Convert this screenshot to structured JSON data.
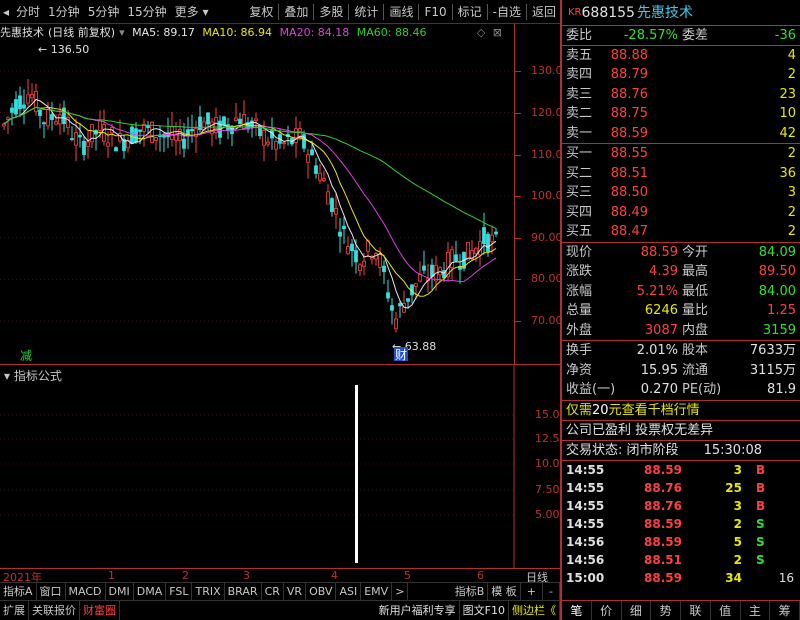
{
  "toolbar": {
    "tabs": [
      "分时",
      "1分钟",
      "5分钟",
      "15分钟",
      "更多"
    ],
    "actions": [
      "复权",
      "叠加",
      "多股",
      "统计",
      "画线",
      "F10",
      "标记",
      "-自选",
      "返回"
    ]
  },
  "chart_header": {
    "stock_name": "先惠技术",
    "period": "(日线 前复权)",
    "ma5": "MA5: 89.17",
    "ma10": "MA10: 86.94",
    "ma20": "MA20: 84.18",
    "ma60": "MA60: 88.46"
  },
  "chart_labels": {
    "high_mark": "136.50",
    "low_mark": "63.88",
    "reduce_marker": "减",
    "finance_marker": "财"
  },
  "price_axis": [
    "130.0",
    "120.0",
    "110.0",
    "100.0",
    "90.00",
    "80.00",
    "70.00"
  ],
  "indicator": {
    "title": "指标公式",
    "axis": [
      "15.00",
      "12.50",
      "10.00",
      "7.50",
      "5.00"
    ]
  },
  "time_axis": {
    "year": "2021年",
    "months": [
      "1",
      "2",
      "3",
      "4",
      "5",
      "6"
    ],
    "right_label": "日线"
  },
  "indicator_tabs": [
    "指标A",
    "窗口",
    "MACD",
    "DMI",
    "DMA",
    "FSL",
    "TRIX",
    "BRAR",
    "CR",
    "VR",
    "OBV",
    "ASI",
    "EMV",
    ">",
    "指标B",
    "模 板",
    "+",
    "-"
  ],
  "status_row": [
    "扩展",
    "关联报价",
    "财富圈",
    "新用户福利专享",
    "图文F10",
    "侧边栏《"
  ],
  "quote": {
    "prefix": "KR",
    "code": "688155",
    "name": "先惠技术",
    "weibi_label": "委比",
    "weibi_value": "-28.57%",
    "weicha_label": "委差",
    "weicha_value": "-36",
    "sells": [
      {
        "label": "卖五",
        "price": "88.88",
        "vol": "4"
      },
      {
        "label": "卖四",
        "price": "88.79",
        "vol": "2"
      },
      {
        "label": "卖三",
        "price": "88.76",
        "vol": "23"
      },
      {
        "label": "卖二",
        "price": "88.75",
        "vol": "10"
      },
      {
        "label": "卖一",
        "price": "88.59",
        "vol": "42"
      }
    ],
    "buys": [
      {
        "label": "买一",
        "price": "88.55",
        "vol": "2"
      },
      {
        "label": "买二",
        "price": "88.51",
        "vol": "36"
      },
      {
        "label": "买三",
        "price": "88.50",
        "vol": "3"
      },
      {
        "label": "买四",
        "price": "88.49",
        "vol": "2"
      },
      {
        "label": "买五",
        "price": "88.47",
        "vol": "2"
      }
    ],
    "stats": [
      {
        "l1": "现价",
        "v1": "88.59",
        "c1": "red",
        "l2": "今开",
        "v2": "84.09",
        "c2": "green"
      },
      {
        "l1": "涨跌",
        "v1": "4.39",
        "c1": "red",
        "l2": "最高",
        "v2": "89.50",
        "c2": "red"
      },
      {
        "l1": "涨幅",
        "v1": "5.21%",
        "c1": "red",
        "l2": "最低",
        "v2": "84.00",
        "c2": "green"
      },
      {
        "l1": "总量",
        "v1": "6246",
        "c1": "yellow",
        "l2": "量比",
        "v2": "1.25",
        "c2": "red"
      },
      {
        "l1": "外盘",
        "v1": "3087",
        "c1": "red",
        "l2": "内盘",
        "v2": "3159",
        "c2": "green"
      }
    ],
    "stats2": [
      {
        "l1": "换手",
        "v1": "2.01%",
        "l2": "股本",
        "v2": "7633万"
      },
      {
        "l1": "净资",
        "v1": "15.95",
        "l2": "流通",
        "v2": "3115万"
      },
      {
        "l1": "收益(一)",
        "v1": "0.270",
        "l2": "PE(动)",
        "v2": "81.9"
      }
    ],
    "promo": "仅需20元查看千档行情",
    "promo_num": "20",
    "notice": "公司已盈利 投票权无差异",
    "trade_status_label": "交易状态: 闭市阶段",
    "trade_status_time": "15:30:08",
    "trades": [
      {
        "time": "14:55",
        "price": "88.59",
        "vol": "3",
        "side": "B"
      },
      {
        "time": "14:55",
        "price": "88.76",
        "vol": "25",
        "side": "B"
      },
      {
        "time": "14:55",
        "price": "88.76",
        "vol": "3",
        "side": "B"
      },
      {
        "time": "14:55",
        "price": "88.59",
        "vol": "2",
        "side": "S"
      },
      {
        "time": "14:56",
        "price": "88.59",
        "vol": "5",
        "side": "S"
      },
      {
        "time": "14:56",
        "price": "88.51",
        "vol": "2",
        "side": "S"
      },
      {
        "time": "15:00",
        "price": "88.59",
        "vol": "34",
        "side": "",
        "extra": "16"
      }
    ],
    "tabs": [
      "笔",
      "价",
      "细",
      "势",
      "联",
      "值",
      "主",
      "筹"
    ]
  },
  "colors": {
    "up": "#ff4040",
    "down": "#30e0e0",
    "ma5": "#e8e8e8",
    "ma10": "#e8e800",
    "ma20": "#e040e0",
    "ma60": "#30d030",
    "border": "#b0302e"
  }
}
